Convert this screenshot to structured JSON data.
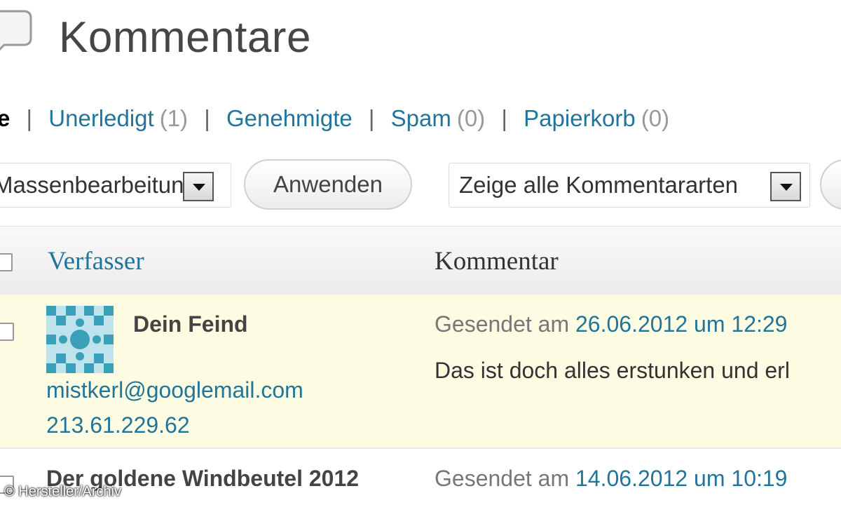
{
  "header": {
    "title": "Kommentare",
    "icon": "speech-bubble-icon"
  },
  "filters": {
    "current_fragment": "e",
    "separator": "|",
    "items": [
      {
        "label": "Unerledigt",
        "count": "(1)"
      },
      {
        "label": "Genehmigte",
        "count": ""
      },
      {
        "label": "Spam",
        "count": "(0)"
      },
      {
        "label": "Papierkorb",
        "count": "(0)"
      }
    ]
  },
  "toolbar": {
    "bulk_action_value": "Massenbearbeitung",
    "apply_label": "Anwenden",
    "comment_type_value": "Zeige alle Kommentararten"
  },
  "table": {
    "columns": {
      "author": "Verfasser",
      "comment": "Kommentar"
    },
    "rows": [
      {
        "author": "Dein Feind",
        "email": "mistkerl@googlemail.com",
        "ip": "213.61.229.62",
        "submitted_prefix": "Gesendet am",
        "submitted_date": "26.06.2012 um 12:29",
        "comment": "Das ist doch alles erstunken und erl"
      },
      {
        "author": "Der goldene Windbeutel 2012",
        "submitted_prefix": "Gesendet am",
        "submitted_date": "14.06.2012 um 10:19"
      }
    ]
  },
  "credit": "© Hersteller/Archiv",
  "colors": {
    "link": "#21759b",
    "highlight_row": "#fefbe3"
  }
}
